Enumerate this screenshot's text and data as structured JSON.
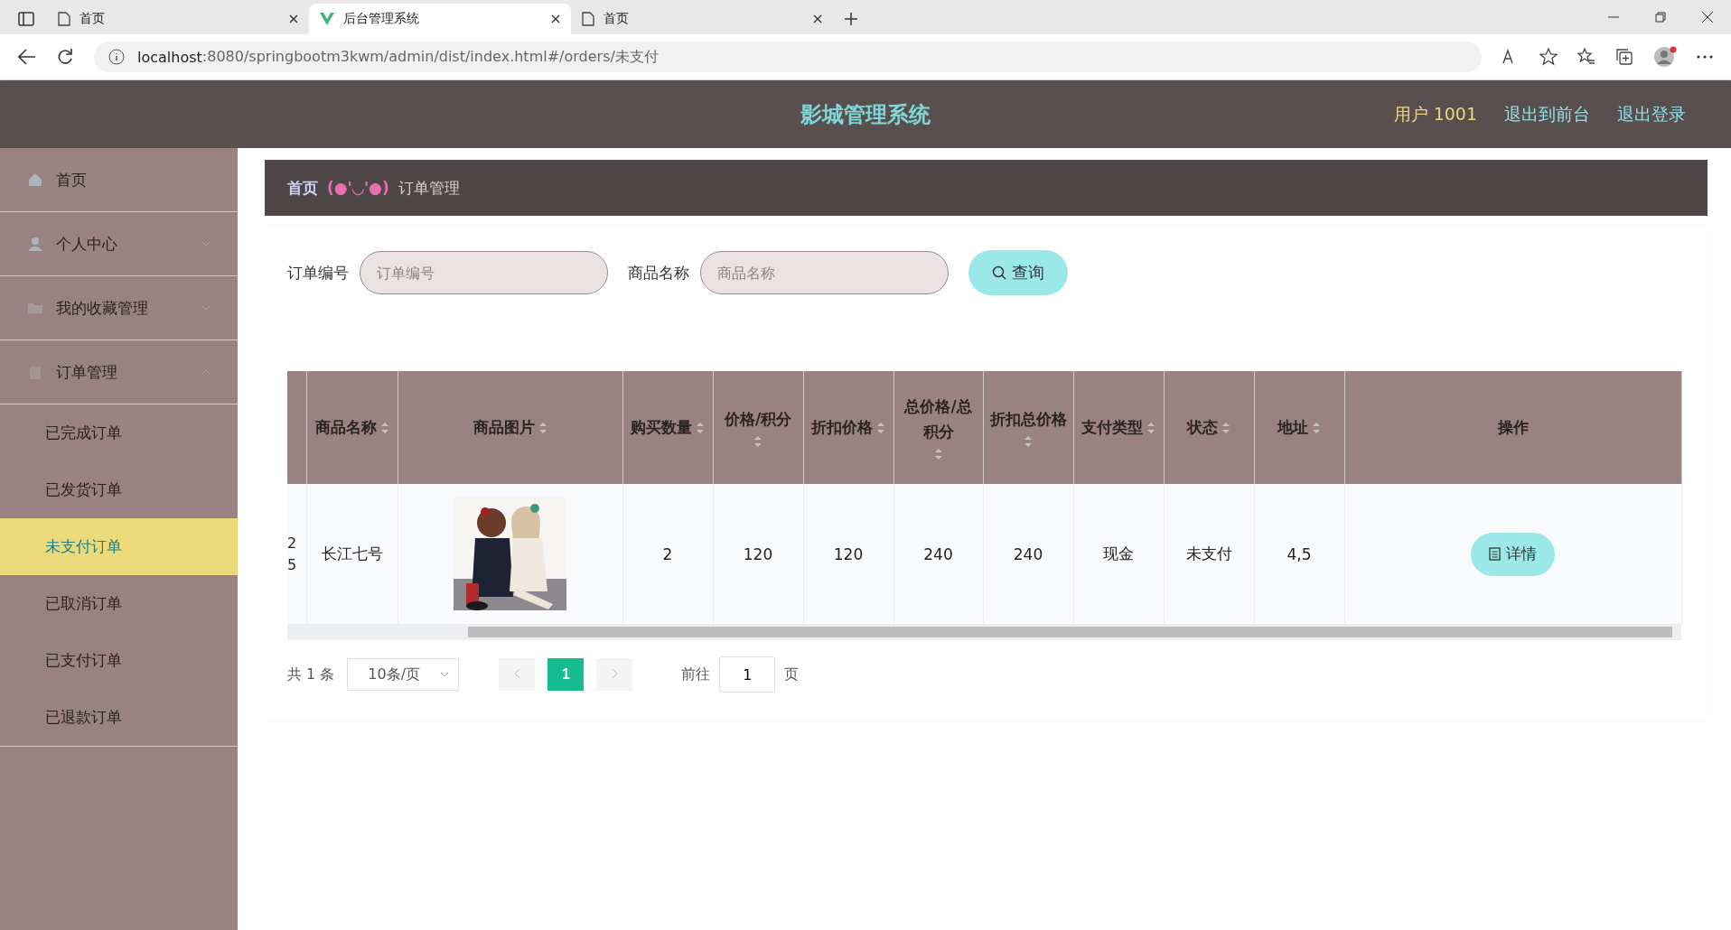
{
  "browser": {
    "tabs": [
      {
        "title": "首页",
        "selected": false
      },
      {
        "title": "后台管理系统",
        "selected": true
      },
      {
        "title": "首页",
        "selected": false
      }
    ],
    "url_host": "localhost",
    "url_rest": ":8080/springbootm3kwm/admin/dist/index.html#/orders/未支付"
  },
  "header": {
    "title": "影城管理系统",
    "user": "用户 1001",
    "links": [
      "退出到前台",
      "退出登录"
    ]
  },
  "sidebar": {
    "items": [
      {
        "label": "首页"
      },
      {
        "label": "个人中心",
        "expanded": false
      },
      {
        "label": "我的收藏管理",
        "expanded": false
      },
      {
        "label": "订单管理",
        "expanded": true,
        "children": [
          {
            "label": "已完成订单",
            "selected": false
          },
          {
            "label": "已发货订单",
            "selected": false
          },
          {
            "label": "未支付订单",
            "selected": true
          },
          {
            "label": "已取消订单",
            "selected": false
          },
          {
            "label": "已支付订单",
            "selected": false
          },
          {
            "label": "已退款订单",
            "selected": false
          }
        ]
      }
    ]
  },
  "breadcrumb": {
    "home": "首页",
    "separator": "(●'◡'●)",
    "current": "订单管理"
  },
  "search": {
    "fields": [
      {
        "label": "订单编号",
        "placeholder": "订单编号"
      },
      {
        "label": "商品名称",
        "placeholder": "商品名称"
      }
    ],
    "button": "查询"
  },
  "table": {
    "columns": [
      {
        "sortable": false
      },
      {
        "label": "商品名称",
        "sortable": true
      },
      {
        "label": "商品图片",
        "sortable": true
      },
      {
        "label": "购买数量",
        "sortable": true
      },
      {
        "label": "价格/积分",
        "sortable": true
      },
      {
        "label": "折扣价格",
        "sortable": true
      },
      {
        "label": "总价格/总积分",
        "sortable": true
      },
      {
        "label": "折扣总价格",
        "sortable": true
      },
      {
        "label": "支付类型",
        "sortable": true
      },
      {
        "label": "状态",
        "sortable": true
      },
      {
        "label": "地址",
        "sortable": true
      },
      {
        "label": "操作",
        "sortable": false
      }
    ],
    "rows": [
      {
        "column_1": [
          "2",
          "5"
        ],
        "name": "长江七号",
        "image": {
          "kind": "picture"
        },
        "quantity": "2",
        "price": "120",
        "discount_price": "120",
        "total": "240",
        "discount_total": "240",
        "pay_type": "现金",
        "status": "未支付",
        "address": "4,5",
        "action": "详情"
      }
    ]
  },
  "pagination": {
    "total": "共 1 条",
    "page_size": "10条/页",
    "pages": [
      {
        "label": "1",
        "selected": true
      }
    ],
    "goto_label": "前往",
    "goto_value": "1",
    "goto_suffix": "页"
  }
}
